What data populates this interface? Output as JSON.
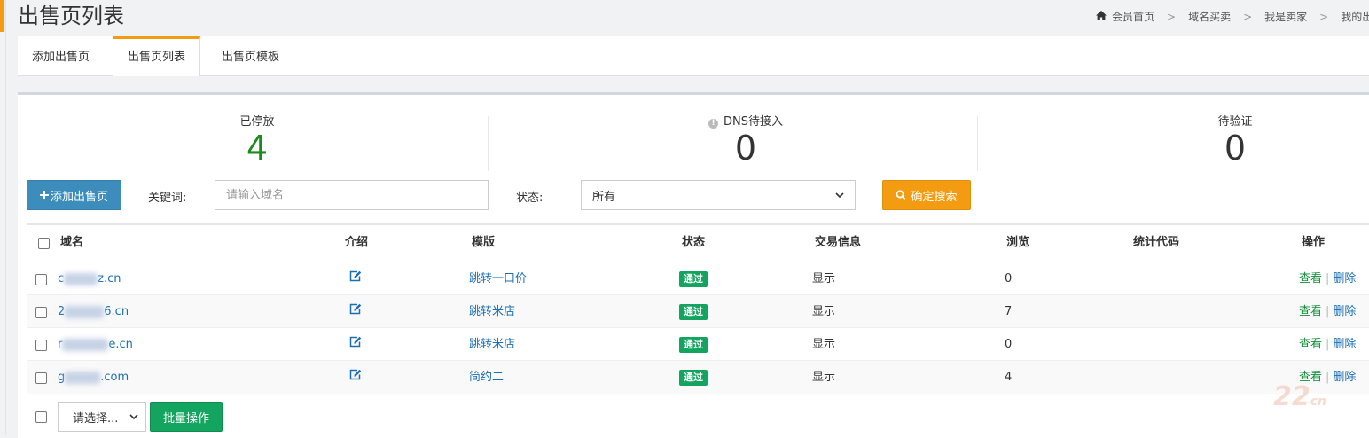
{
  "page": {
    "title": "出售页列表"
  },
  "breadcrumb": {
    "items": [
      "会员首页",
      "域名买卖",
      "我是卖家",
      "我的出"
    ],
    "separator": ">"
  },
  "tabs": [
    {
      "label": "添加出售页",
      "active": false
    },
    {
      "label": "出售页列表",
      "active": true
    },
    {
      "label": "出售页模板",
      "active": false
    }
  ],
  "stats": [
    {
      "label": "已停放",
      "value": "4"
    },
    {
      "label": "DNS待接入",
      "value": "0"
    },
    {
      "label": "待验证",
      "value": "0"
    }
  ],
  "toolbar": {
    "add_label": "添加出售页",
    "keyword_label": "关键词:",
    "keyword_placeholder": "请输入域名",
    "status_label": "状态:",
    "status_selected": "所有",
    "search_label": "确定搜索"
  },
  "table": {
    "headers": [
      "域名",
      "介绍",
      "模版",
      "状态",
      "交易信息",
      "浏览",
      "统计代码",
      "操作"
    ],
    "rows": [
      {
        "domain_prefix": "c",
        "domain_suffix": "z.cn",
        "template": "跳转一口价",
        "status": "通过",
        "trade_info": "显示",
        "views": "0",
        "stats_code": "",
        "view_label": "查看",
        "delete_label": "删除"
      },
      {
        "domain_prefix": "2",
        "domain_suffix": "6.cn",
        "template": "跳转米店",
        "status": "通过",
        "trade_info": "显示",
        "views": "7",
        "stats_code": "",
        "view_label": "查看",
        "delete_label": "删除"
      },
      {
        "domain_prefix": "r",
        "domain_suffix": "e.cn",
        "template": "跳转米店",
        "status": "通过",
        "trade_info": "显示",
        "views": "0",
        "stats_code": "",
        "view_label": "查看",
        "delete_label": "删除"
      },
      {
        "domain_prefix": "g",
        "domain_suffix": ".com",
        "template": "简约二",
        "status": "通过",
        "trade_info": "显示",
        "views": "4",
        "stats_code": "",
        "view_label": "查看",
        "delete_label": "删除"
      }
    ]
  },
  "footer": {
    "batch_select": "请选择...",
    "batch_button": "批量操作"
  },
  "watermark": {
    "main": "22",
    "small": "cn"
  },
  "colors": {
    "accent_orange": "#f39c12",
    "primary_blue": "#3c8dbc",
    "success_green": "#13a55f",
    "link_blue": "#1b6fb4",
    "stat_green": "#1a8c1a"
  }
}
